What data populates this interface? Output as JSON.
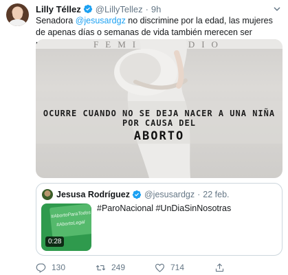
{
  "tweet": {
    "display_name": "Lilly Téllez",
    "handle": "@LillyTellez",
    "separator": "·",
    "time": "9h",
    "text_before": "Senadora ",
    "mention": "@jesusardgz",
    "text_after": " no discrimine por la edad, las mujeres de apenas días o semanas de vida también merecen ser protegidas",
    "emoji": "praying-hands-emoji"
  },
  "media": {
    "title_strip": "FEMINICIDIO",
    "line1": "OCURRE CUANDO NO SE DEJA NACER A UNA NIÑA",
    "line2": "POR CAUSA DEL",
    "line3": "ABORTO"
  },
  "quote": {
    "display_name": "Jesusa Rodríguez",
    "handle": "@jesusardgz",
    "separator": "·",
    "date": "22 feb.",
    "text": "#ParoNacional #UnDiaSinNosotras",
    "video_duration": "0:28",
    "thumb_tag1": "#AbortoParaTodos",
    "thumb_tag2": "#AbortoLegal"
  },
  "actions": {
    "reply_count": "130",
    "retweet_count": "249",
    "like_count": "714"
  },
  "icons": {
    "verified": "verified-badge-icon",
    "caret": "chevron-down-icon",
    "reply": "reply-icon",
    "retweet": "retweet-icon",
    "like": "heart-icon",
    "share": "share-icon"
  },
  "colors": {
    "accent": "#1da1f2",
    "secondary_text": "#657786",
    "border": "#ccd6dd"
  }
}
